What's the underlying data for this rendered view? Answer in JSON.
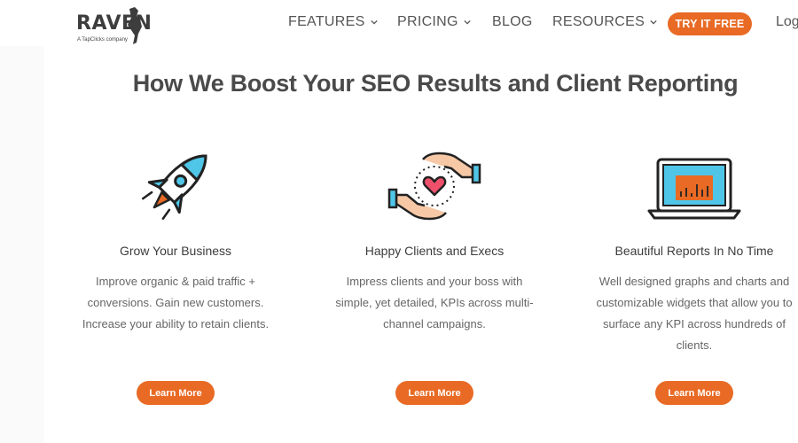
{
  "logo": {
    "word": "RAVEN",
    "tagline": "A TapClicks company"
  },
  "nav": {
    "items": [
      {
        "label": "FEATURES",
        "has_dropdown": true
      },
      {
        "label": "PRICING",
        "has_dropdown": true
      },
      {
        "label": "BLOG",
        "has_dropdown": false
      },
      {
        "label": "RESOURCES",
        "has_dropdown": true
      }
    ],
    "cta": "TRY IT FREE",
    "login": "Log"
  },
  "headline": "How We Boost Your SEO Results and Client Reporting",
  "features": [
    {
      "icon": "rocket-icon",
      "title": "Grow Your Business",
      "text": "Improve organic & paid traffic + conversions. Gain new customers. Increase your ability to retain clients.",
      "button": "Learn More"
    },
    {
      "icon": "hands-heart-icon",
      "title": "Happy Clients and Execs",
      "text": "Impress clients and your boss with simple, yet detailed, KPIs across multi-channel campaigns.",
      "button": "Learn More"
    },
    {
      "icon": "laptop-report-icon",
      "title": "Beautiful Reports In No Time",
      "text": "Well designed graphs and charts and customizable widgets that allow you to surface any KPI across hundreds of clients.",
      "button": "Learn More"
    }
  ],
  "colors": {
    "accent": "#e86a24",
    "icon_blue": "#4fc6e8",
    "text": "#555555"
  }
}
